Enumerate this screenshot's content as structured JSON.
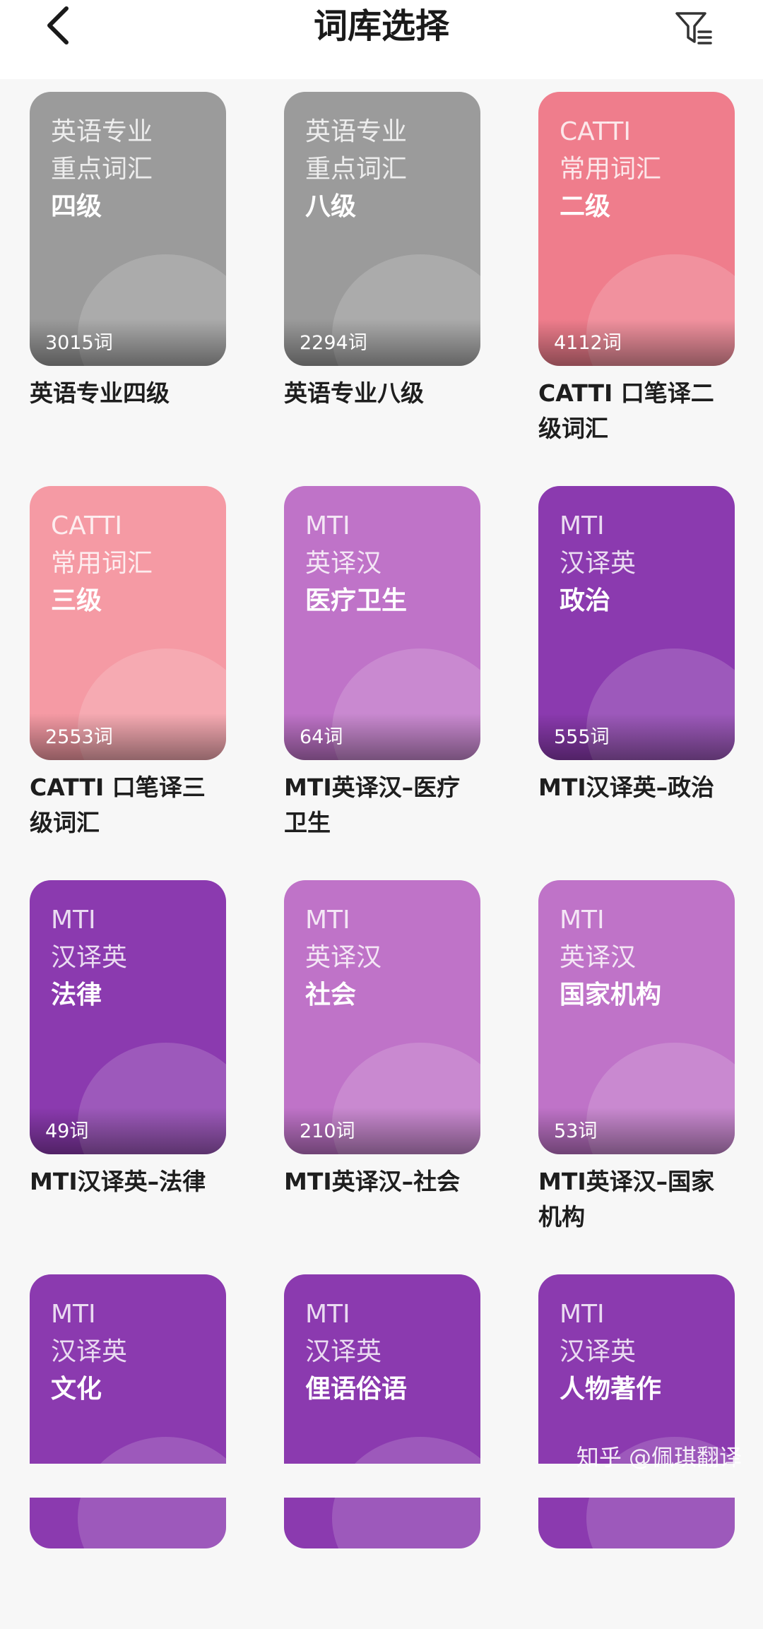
{
  "header": {
    "title": "词库选择",
    "back_icon": "chevron-left-icon",
    "filter_icon": "filter-icon"
  },
  "colors": {
    "gray": "#9b9b9b",
    "coral": "#ef7d8c",
    "pink": "#f59aa4",
    "orchid": "#bf73c8",
    "purple": "#8b3aaf",
    "background": "#f7f7f7"
  },
  "cards": [
    {
      "lines": [
        "英语专业",
        "重点词汇",
        "四级"
      ],
      "count": "3015词",
      "name": "英语专业四级",
      "color": "#9b9b9b"
    },
    {
      "lines": [
        "英语专业",
        "重点词汇",
        "八级"
      ],
      "count": "2294词",
      "name": "英语专业八级",
      "color": "#9b9b9b"
    },
    {
      "lines": [
        "CATTI",
        "常用词汇",
        "二级"
      ],
      "count": "4112词",
      "name": "CATTI 口笔译二级词汇",
      "color": "#ef7d8c"
    },
    {
      "lines": [
        "CATTI",
        "常用词汇",
        "三级"
      ],
      "count": "2553词",
      "name": "CATTI 口笔译三级词汇",
      "color": "#f59aa4"
    },
    {
      "lines": [
        "MTI",
        "英译汉",
        "医疗卫生"
      ],
      "count": "64词",
      "name": "MTI英译汉–医疗卫生",
      "color": "#bf73c8"
    },
    {
      "lines": [
        "MTI",
        "汉译英",
        "政治"
      ],
      "count": "555词",
      "name": "MTI汉译英–政治",
      "color": "#8b3aaf"
    },
    {
      "lines": [
        "MTI",
        "汉译英",
        "法律"
      ],
      "count": "49词",
      "name": "MTI汉译英–法律",
      "color": "#8b3aaf"
    },
    {
      "lines": [
        "MTI",
        "英译汉",
        "社会"
      ],
      "count": "210词",
      "name": "MTI英译汉–社会",
      "color": "#bf73c8"
    },
    {
      "lines": [
        "MTI",
        "英译汉",
        "国家机构"
      ],
      "count": "53词",
      "name": "MTI英译汉–国家机构",
      "color": "#bf73c8"
    },
    {
      "lines": [
        "MTI",
        "汉译英",
        "文化"
      ],
      "count": "",
      "name": "",
      "color": "#8b3aaf"
    },
    {
      "lines": [
        "MTI",
        "汉译英",
        "俚语俗语"
      ],
      "count": "",
      "name": "",
      "color": "#8b3aaf"
    },
    {
      "lines": [
        "MTI",
        "汉译英",
        "人物著作"
      ],
      "count": "",
      "name": "",
      "color": "#8b3aaf"
    }
  ],
  "watermark": "知乎 @佩琪翻译"
}
